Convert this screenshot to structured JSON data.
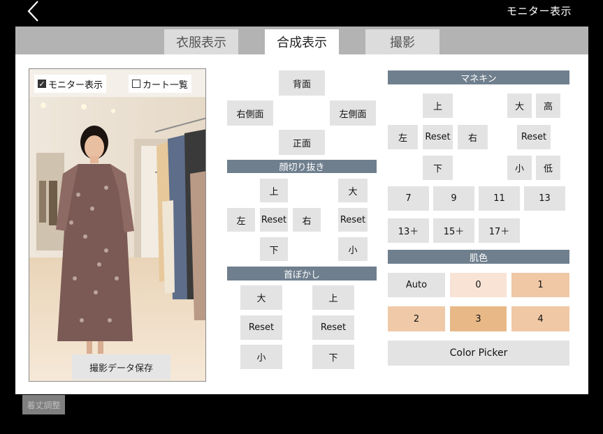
{
  "header": {
    "back_icon": "chevron-left-icon",
    "title": "モニター表示"
  },
  "tabs": [
    {
      "label": "衣服表示",
      "active": false
    },
    {
      "label": "合成表示",
      "active": true
    },
    {
      "label": "撮影",
      "active": false
    }
  ],
  "preview": {
    "monitor_checkbox": {
      "label": "モニター表示",
      "checked": true
    },
    "cart_checkbox": {
      "label": "カート一覧",
      "checked": false
    },
    "save_label": "撮影データ保存"
  },
  "view": {
    "back": "背面",
    "right_side": "右側面",
    "left_side": "左側面",
    "front": "正面"
  },
  "face_crop": {
    "title": "顔切り抜き",
    "up": "上",
    "left": "左",
    "reset_pos": "Reset",
    "right": "右",
    "down": "下",
    "big": "大",
    "reset_size": "Reset",
    "small": "小"
  },
  "neck_blur": {
    "title": "首ぼかし",
    "big": "大",
    "reset_size": "Reset",
    "small": "小",
    "up": "上",
    "reset_pos": "Reset",
    "down": "下"
  },
  "mannequin": {
    "title": "マネキン",
    "up": "上",
    "left": "左",
    "reset_pos": "Reset",
    "right": "右",
    "down": "下",
    "big": "大",
    "high": "高",
    "reset_size": "Reset",
    "small": "小",
    "low": "低",
    "sizes": [
      "7",
      "9",
      "11",
      "13",
      "13＋",
      "15＋",
      "17＋"
    ]
  },
  "skin": {
    "title": "肌色",
    "auto": "Auto",
    "swatches": [
      "0",
      "1",
      "2",
      "3",
      "4"
    ],
    "color_picker": "Color Picker"
  },
  "footer": {
    "adjust_label": "着丈調整"
  }
}
